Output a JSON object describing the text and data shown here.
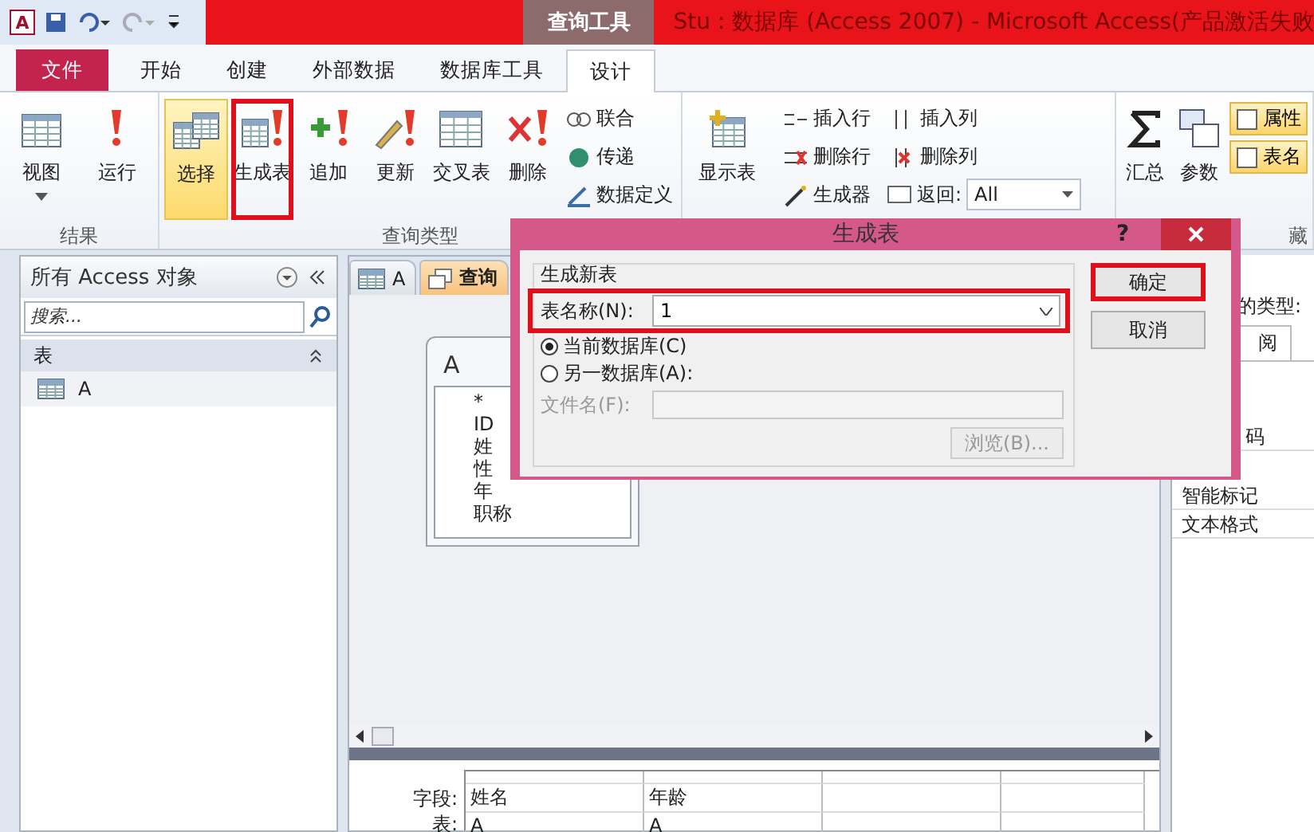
{
  "window": {
    "app_letter": "A",
    "title": "Stu : 数据库 (Access 2007) - Microsoft Access(产品激活失败",
    "context_tab": "查询工具"
  },
  "ribbon_tabs": [
    {
      "label": "文件",
      "kind": "file",
      "selected": false
    },
    {
      "label": "开始",
      "kind": "tab",
      "selected": false
    },
    {
      "label": "创建",
      "kind": "tab",
      "selected": false
    },
    {
      "label": "外部数据",
      "kind": "tab",
      "selected": false
    },
    {
      "label": "数据库工具",
      "kind": "tab",
      "selected": false
    },
    {
      "label": "设计",
      "kind": "tab",
      "selected": true
    }
  ],
  "ribbon": {
    "results": {
      "label": "结果",
      "buttons": [
        {
          "label": "视图",
          "dropdown": true
        },
        {
          "label": "运行",
          "dropdown": false
        }
      ]
    },
    "query_type": {
      "label": "查询类型",
      "buttons": [
        {
          "label": "选择",
          "selected": true,
          "highlighted": false
        },
        {
          "label": "生成表",
          "selected": false,
          "highlighted": true
        },
        {
          "label": "追加",
          "selected": false,
          "highlighted": false
        },
        {
          "label": "更新",
          "selected": false,
          "highlighted": false
        },
        {
          "label": "交叉表",
          "selected": false,
          "highlighted": false
        },
        {
          "label": "删除",
          "selected": false,
          "highlighted": false
        }
      ],
      "small_buttons": [
        "联合",
        "传递",
        "数据定义"
      ]
    },
    "query_setup": {
      "show_table": "显示表",
      "row_buttons": [
        "插入行",
        "删除行",
        "生成器"
      ],
      "column_buttons": [
        "插入列",
        "删除列"
      ],
      "return_label": "返回:",
      "return_value": "All"
    },
    "show_hide": {
      "label": "藏",
      "buttons": [
        "汇总",
        "参数"
      ],
      "small_buttons": [
        "属性",
        "表名"
      ]
    }
  },
  "nav": {
    "title": "所有 Access 对象",
    "search_placeholder": "搜索...",
    "sections": [
      {
        "label": "表",
        "expanded": true,
        "items": [
          {
            "label": "A"
          }
        ]
      }
    ]
  },
  "doc_tabs": [
    {
      "label": "A",
      "selected": false
    },
    {
      "label": "查询",
      "selected": true
    }
  ],
  "field_list": {
    "title": "A",
    "fields": [
      "*",
      "ID",
      "姓",
      "性",
      "年",
      "职称"
    ]
  },
  "grid": {
    "row_labels": [
      "字段:",
      "表:"
    ],
    "columns": [
      {
        "field": "姓名",
        "table": "A"
      },
      {
        "field": "年龄",
        "table": "A"
      }
    ]
  },
  "property_sheet": {
    "type_label": "的类型:",
    "tab": "阅",
    "rows": [
      "码",
      "智能标记",
      "文本格式"
    ]
  },
  "dialog": {
    "title": "生成表",
    "help": "?",
    "group_label": "生成新表",
    "name_label": "表名称(N):",
    "name_value": "1",
    "name_highlighted": true,
    "options": [
      {
        "label": "当前数据库(C)",
        "selected": true
      },
      {
        "label": "另一数据库(A):",
        "selected": false
      }
    ],
    "file_label": "文件名(F):",
    "file_disabled": true,
    "browse": "浏览(B)...",
    "buttons": [
      {
        "label": "确定",
        "highlighted": true
      },
      {
        "label": "取消",
        "highlighted": false
      }
    ]
  }
}
